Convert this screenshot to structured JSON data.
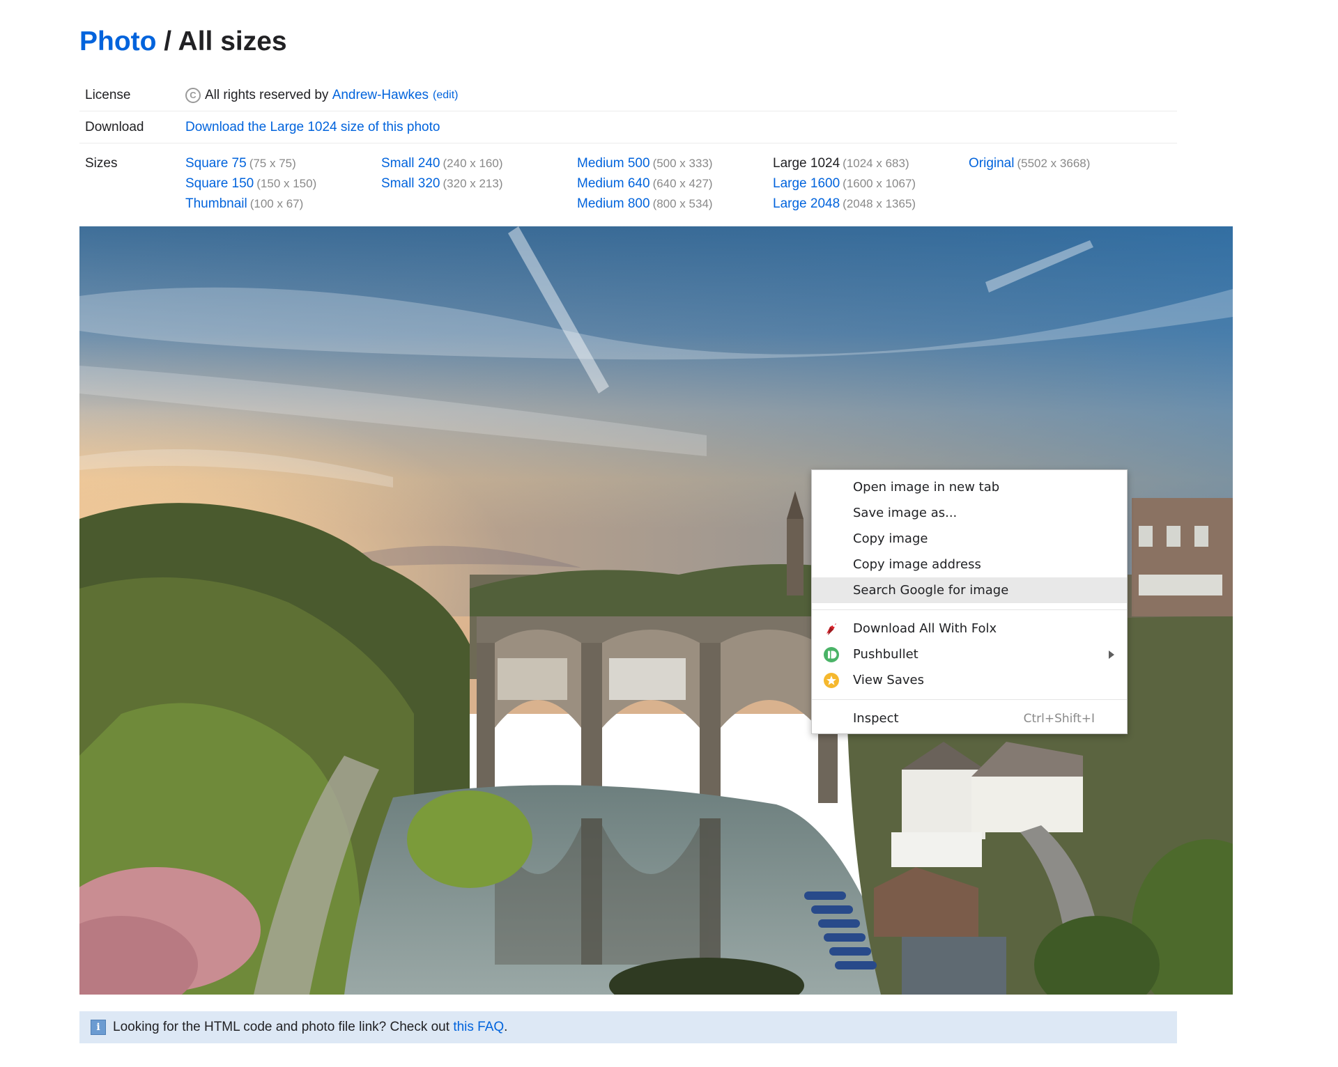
{
  "header": {
    "title_link": "Photo",
    "title_sep": " / ",
    "title_rest": "All sizes"
  },
  "license": {
    "label": "License",
    "icon": "copyright-icon",
    "text": "All rights reserved by",
    "owner": "Andrew-Hawkes",
    "edit": "(edit)"
  },
  "download": {
    "label": "Download",
    "link": "Download the Large 1024 size of this photo"
  },
  "sizes": {
    "label": "Sizes",
    "columns": [
      [
        {
          "name": "Square 75",
          "dims": "(75 x 75)"
        },
        {
          "name": "Square 150",
          "dims": "(150 x 150)"
        },
        {
          "name": "Thumbnail",
          "dims": "(100 x 67)"
        }
      ],
      [
        {
          "name": "Small 240",
          "dims": "(240 x 160)"
        },
        {
          "name": "Small 320",
          "dims": "(320 x 213)"
        }
      ],
      [
        {
          "name": "Medium 500",
          "dims": "(500 x 333)"
        },
        {
          "name": "Medium 640",
          "dims": "(640 x 427)"
        },
        {
          "name": "Medium 800",
          "dims": "(800 x 534)"
        }
      ],
      [
        {
          "name": "Large 1024",
          "dims": "(1024 x 683)",
          "current": true
        },
        {
          "name": "Large 1600",
          "dims": "(1600 x 1067)"
        },
        {
          "name": "Large 2048",
          "dims": "(2048 x 1365)"
        }
      ],
      [
        {
          "name": "Original",
          "dims": "(5502 x 3668)"
        }
      ]
    ]
  },
  "context_menu": {
    "items": [
      {
        "label": "Open image in new tab"
      },
      {
        "label": "Save image as..."
      },
      {
        "label": "Copy image"
      },
      {
        "label": "Copy image address"
      },
      {
        "label": "Search Google for image",
        "hover": true
      }
    ],
    "extensions": [
      {
        "label": "Download All With Folx",
        "icon": "folx-icon"
      },
      {
        "label": "Pushbullet",
        "icon": "pushbullet-icon",
        "submenu": true
      },
      {
        "label": "View Saves",
        "icon": "view-saves-icon"
      }
    ],
    "inspect": {
      "label": "Inspect",
      "shortcut": "Ctrl+Shift+I"
    }
  },
  "faq": {
    "icon": "info-icon",
    "text": "Looking for the HTML code and photo file link? Check out",
    "link": "this FAQ",
    "end": "."
  },
  "colors": {
    "link": "#0063dc",
    "faq_bg": "#dde8f5",
    "menu_hover": "#e8e8e8"
  }
}
